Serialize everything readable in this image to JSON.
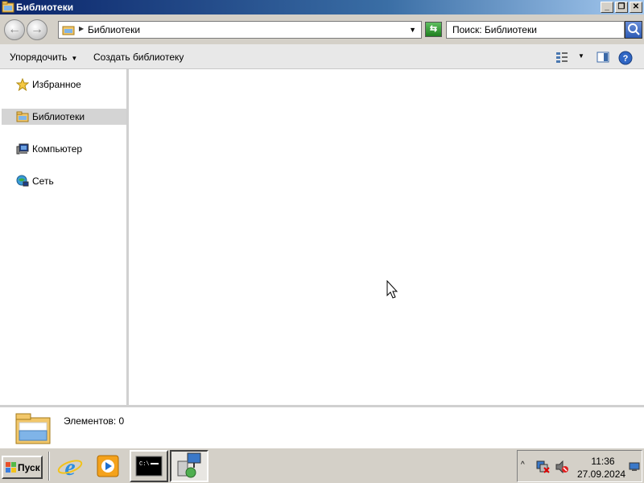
{
  "window": {
    "title": "Библиотеки"
  },
  "address": {
    "path": "Библиотеки"
  },
  "search": {
    "placeholder": "Поиск: Библиотеки"
  },
  "toolbar": {
    "organize": "Упорядочить",
    "create_library": "Создать библиотеку"
  },
  "nav": {
    "items": [
      {
        "label": "Избранное",
        "icon": "star-icon"
      },
      {
        "label": "Библиотеки",
        "icon": "libraries-icon",
        "selected": true
      },
      {
        "label": "Компьютер",
        "icon": "computer-icon"
      },
      {
        "label": "Сеть",
        "icon": "network-icon"
      }
    ]
  },
  "details": {
    "count_text": "Элементов: 0"
  },
  "taskbar": {
    "start_label": "Пуск",
    "tasks": [
      "internet-explorer-icon",
      "media-player-icon",
      "cmd-icon",
      "network-setup-icon"
    ],
    "clock_time": "11:36",
    "clock_date": "27.09.2024"
  },
  "colors": {
    "titlebar": "#0a246a",
    "selection": "#d4d4d4",
    "taskbar": "#d4d0c8"
  }
}
